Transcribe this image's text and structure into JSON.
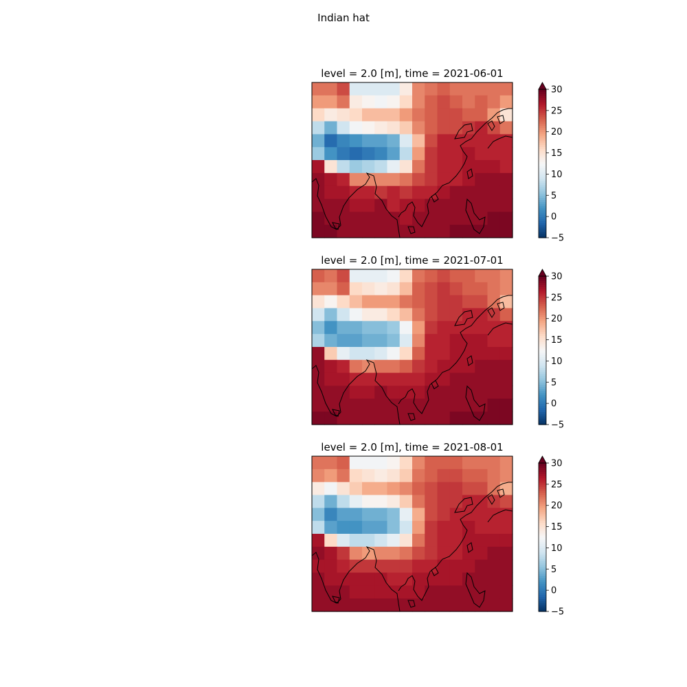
{
  "figure": {
    "suptitle": "Indian hat"
  },
  "colormap": {
    "name": "RdBu_r",
    "stops": [
      "#053061",
      "#2166ac",
      "#4393c3",
      "#92c5de",
      "#d1e5f0",
      "#f7f7f7",
      "#fddbc7",
      "#f4a582",
      "#d6604d",
      "#b2182b",
      "#67001f"
    ],
    "extend": "max",
    "vmin": -5,
    "vmax": 30
  },
  "chart_data": [
    {
      "type": "heatmap",
      "title": "level = 2.0 [m], time = 2021-06-01",
      "colorbar_ticks": [
        "30",
        "25",
        "20",
        "15",
        "10",
        "5",
        "0",
        "−5"
      ],
      "colorbar_values": [
        30,
        25,
        20,
        15,
        10,
        5,
        0,
        -5
      ],
      "grid": [
        [
          22,
          22,
          24,
          10,
          10,
          10,
          10,
          14,
          21,
          22,
          23,
          22,
          22,
          22,
          22,
          22
        ],
        [
          20,
          20,
          22,
          14,
          13,
          12,
          13,
          16,
          21,
          23,
          24,
          23,
          22,
          23,
          22,
          20
        ],
        [
          16,
          14,
          15,
          16,
          18,
          18,
          18,
          20,
          22,
          23,
          24,
          24,
          23,
          23,
          20,
          15
        ],
        [
          8,
          4,
          9,
          12,
          13,
          14,
          15,
          17,
          21,
          23,
          24,
          24,
          25,
          26,
          24,
          22
        ],
        [
          4,
          -1,
          1,
          2,
          3,
          3,
          4,
          10,
          18,
          24,
          26,
          26,
          26,
          26,
          26,
          26
        ],
        [
          6,
          2,
          0,
          -1,
          0,
          1,
          3,
          8,
          20,
          25,
          26,
          26,
          27,
          26,
          26,
          26
        ],
        [
          27,
          15,
          8,
          6,
          7,
          8,
          11,
          15,
          22,
          25,
          26,
          26,
          27,
          27,
          27,
          26
        ],
        [
          28,
          27,
          26,
          21,
          21,
          21,
          21,
          22,
          24,
          25,
          26,
          26,
          27,
          28,
          28,
          28
        ],
        [
          28,
          27,
          27,
          26,
          26,
          25,
          26,
          25,
          26,
          26,
          27,
          28,
          28,
          28,
          28,
          28
        ],
        [
          28,
          28,
          28,
          27,
          27,
          28,
          26,
          27,
          27,
          28,
          28,
          28,
          28,
          28,
          28,
          28
        ],
        [
          29,
          28,
          28,
          28,
          28,
          28,
          28,
          27,
          28,
          28,
          28,
          28,
          28,
          28,
          29,
          29
        ],
        [
          29,
          29,
          28,
          28,
          28,
          28,
          28,
          28,
          28,
          28,
          28,
          29,
          29,
          29,
          29,
          29
        ]
      ]
    },
    {
      "type": "heatmap",
      "title": "level = 2.0 [m], time = 2021-07-01",
      "colorbar_ticks": [
        "30",
        "25",
        "20",
        "15",
        "10",
        "5",
        "0",
        "−5"
      ],
      "colorbar_values": [
        30,
        25,
        20,
        15,
        10,
        5,
        0,
        -5
      ],
      "grid": [
        [
          23,
          22,
          24,
          11,
          11,
          11,
          12,
          16,
          22,
          23,
          24,
          23,
          23,
          22,
          22,
          21
        ],
        [
          21,
          21,
          23,
          16,
          15,
          14,
          15,
          18,
          23,
          24,
          25,
          24,
          23,
          23,
          22,
          21
        ],
        [
          15,
          13,
          16,
          18,
          20,
          20,
          20,
          22,
          23,
          24,
          25,
          25,
          24,
          24,
          22,
          18
        ],
        [
          9,
          5,
          9,
          12,
          14,
          14,
          16,
          18,
          22,
          24,
          25,
          25,
          26,
          26,
          25,
          23
        ],
        [
          5,
          2,
          4,
          4,
          5,
          5,
          6,
          12,
          20,
          25,
          26,
          26,
          26,
          26,
          26,
          26
        ],
        [
          7,
          4,
          3,
          3,
          4,
          4,
          5,
          10,
          21,
          26,
          26,
          27,
          27,
          27,
          26,
          26
        ],
        [
          28,
          17,
          11,
          9,
          9,
          10,
          12,
          16,
          23,
          26,
          26,
          27,
          27,
          27,
          27,
          27
        ],
        [
          28,
          27,
          26,
          22,
          21,
          22,
          22,
          23,
          25,
          26,
          27,
          27,
          27,
          28,
          28,
          28
        ],
        [
          28,
          27,
          27,
          26,
          26,
          26,
          26,
          26,
          26,
          27,
          27,
          28,
          28,
          28,
          28,
          28
        ],
        [
          28,
          28,
          28,
          27,
          27,
          28,
          27,
          27,
          27,
          28,
          28,
          28,
          28,
          28,
          28,
          28
        ],
        [
          28,
          28,
          28,
          28,
          28,
          28,
          28,
          28,
          28,
          28,
          28,
          28,
          28,
          28,
          29,
          29
        ],
        [
          29,
          29,
          28,
          28,
          28,
          28,
          28,
          28,
          28,
          28,
          28,
          29,
          29,
          29,
          29,
          29
        ]
      ]
    },
    {
      "type": "heatmap",
      "title": "level = 2.0 [m], time = 2021-08-01",
      "colorbar_ticks": [
        "30",
        "25",
        "20",
        "15",
        "10",
        "5",
        "0",
        "−5"
      ],
      "colorbar_values": [
        30,
        25,
        20,
        15,
        10,
        5,
        0,
        -5
      ],
      "grid": [
        [
          22,
          22,
          23,
          12,
          12,
          12,
          13,
          16,
          21,
          23,
          23,
          23,
          22,
          22,
          22,
          21
        ],
        [
          21,
          20,
          22,
          16,
          15,
          14,
          15,
          17,
          22,
          23,
          24,
          24,
          23,
          23,
          22,
          21
        ],
        [
          14,
          12,
          15,
          17,
          19,
          19,
          20,
          21,
          23,
          24,
          25,
          25,
          24,
          24,
          22,
          19
        ],
        [
          8,
          4,
          8,
          11,
          13,
          13,
          14,
          17,
          22,
          24,
          25,
          25,
          26,
          26,
          25,
          24
        ],
        [
          5,
          1,
          3,
          3,
          4,
          4,
          5,
          11,
          19,
          24,
          25,
          26,
          26,
          26,
          26,
          26
        ],
        [
          8,
          3,
          2,
          2,
          3,
          3,
          5,
          9,
          20,
          25,
          26,
          26,
          27,
          26,
          26,
          26
        ],
        [
          27,
          16,
          10,
          8,
          8,
          9,
          11,
          15,
          22,
          25,
          26,
          26,
          27,
          27,
          27,
          27
        ],
        [
          28,
          27,
          25,
          21,
          20,
          21,
          21,
          22,
          24,
          25,
          26,
          26,
          27,
          27,
          28,
          28
        ],
        [
          27,
          27,
          26,
          25,
          25,
          25,
          25,
          25,
          26,
          26,
          27,
          27,
          27,
          28,
          28,
          28
        ],
        [
          28,
          27,
          27,
          27,
          27,
          27,
          26,
          26,
          27,
          27,
          27,
          27,
          28,
          28,
          28,
          28
        ],
        [
          28,
          28,
          28,
          27,
          27,
          27,
          27,
          27,
          27,
          28,
          28,
          28,
          28,
          28,
          28,
          28
        ],
        [
          28,
          28,
          28,
          28,
          28,
          28,
          28,
          28,
          28,
          28,
          28,
          28,
          28,
          28,
          28,
          28
        ]
      ]
    }
  ]
}
